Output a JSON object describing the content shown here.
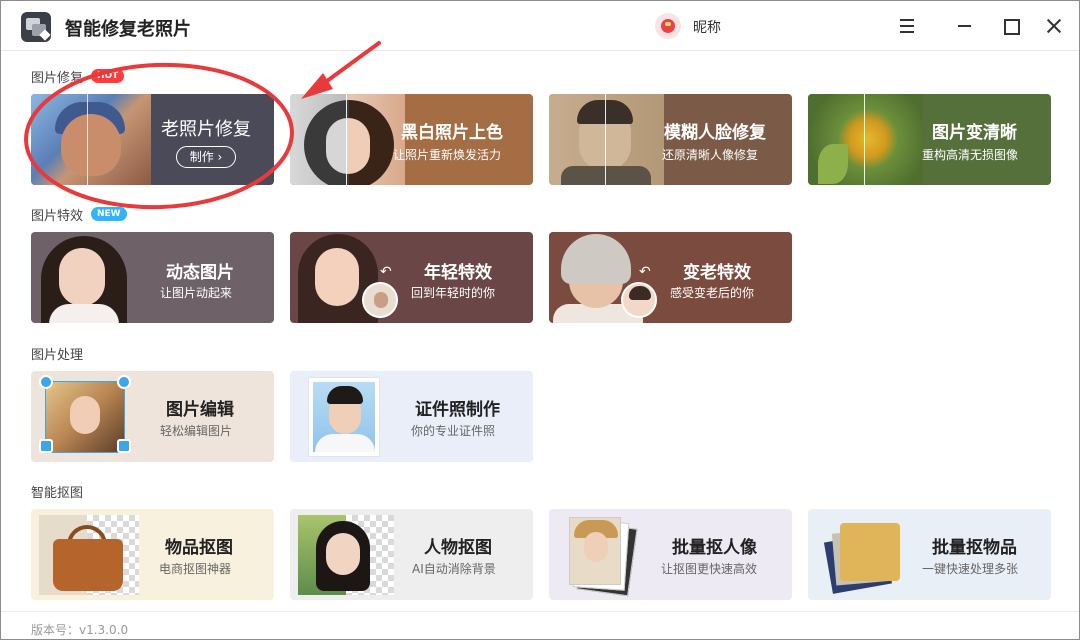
{
  "app": {
    "title": "智能修复老照片",
    "nickname": "昵称"
  },
  "sections": {
    "restore": {
      "title": "图片修复",
      "badge": "HOT"
    },
    "effects": {
      "title": "图片特效",
      "badge": "NEW"
    },
    "process": {
      "title": "图片处理"
    },
    "cutout": {
      "title": "智能抠图"
    }
  },
  "cards": {
    "old_photo": {
      "title": "老照片修复",
      "button": "制作 ›"
    },
    "bw_color": {
      "title": "黑白照片上色",
      "subtitle": "让照片重新焕发活力"
    },
    "blur_face": {
      "title": "模糊人脸修复",
      "subtitle": "还原清晰人像修复"
    },
    "sharpen": {
      "title": "图片变清晰",
      "subtitle": "重构高清无损图像"
    },
    "dynamic": {
      "title": "动态图片",
      "subtitle": "让图片动起来"
    },
    "young": {
      "title": "年轻特效",
      "subtitle": "回到年轻时的你"
    },
    "aged": {
      "title": "变老特效",
      "subtitle": "感受变老后的你"
    },
    "edit": {
      "title": "图片编辑",
      "subtitle": "轻松编辑图片"
    },
    "id_photo": {
      "title": "证件照制作",
      "subtitle": "你的专业证件照"
    },
    "item_cut": {
      "title": "物品抠图",
      "subtitle": "电商抠图神器"
    },
    "person_cut": {
      "title": "人物抠图",
      "subtitle": "AI自动消除背景"
    },
    "batch_person": {
      "title": "批量抠人像",
      "subtitle": "让抠图更快速高效"
    },
    "batch_item": {
      "title": "批量抠物品",
      "subtitle": "一键快速处理多张"
    }
  },
  "status": {
    "version": "版本号：v1.3.0.0"
  },
  "colors": {
    "annotation": "#e8393b",
    "hot_badge": "#ff3b3b",
    "new_badge": "#31b3ff"
  }
}
